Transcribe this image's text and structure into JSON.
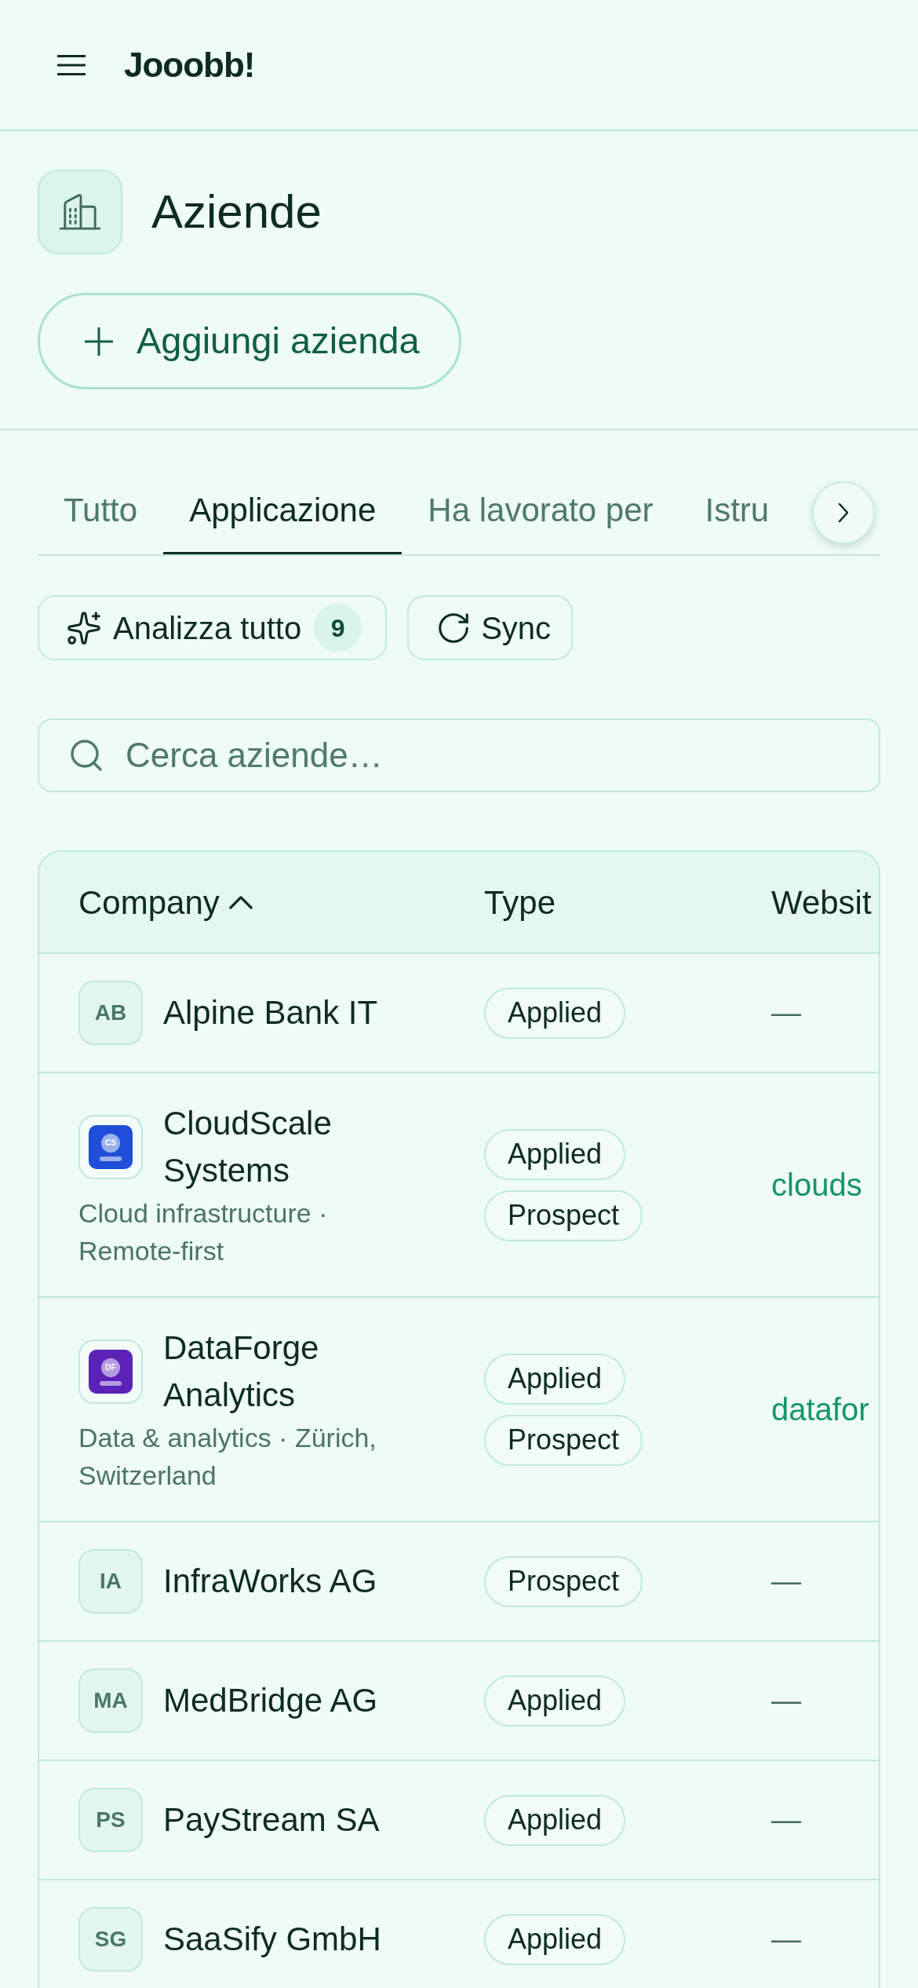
{
  "app_bar": {
    "title": "Jooobb!"
  },
  "page": {
    "title": "Aziende",
    "add_button": "Aggiungi azienda"
  },
  "tabs": [
    {
      "label": "Tutto",
      "selected": false
    },
    {
      "label": "Applicazione",
      "selected": true
    },
    {
      "label": "Ha lavorato per",
      "selected": false
    },
    {
      "label": "Istru",
      "selected": false
    }
  ],
  "actions": [
    {
      "kind": "analyze",
      "label": "Analizza tutto",
      "count": "9"
    },
    {
      "kind": "sync",
      "label": "Sync"
    }
  ],
  "search": {
    "placeholder": "Cerca aziende…"
  },
  "table": {
    "columns": [
      {
        "label": "Company",
        "sorted": true
      },
      {
        "label": "Type",
        "sorted": false
      },
      {
        "label": "Websit",
        "sorted": false
      }
    ],
    "rows": [
      {
        "avatar": {
          "kind": "initials",
          "text": "AB"
        },
        "name": "Alpine Bank IT",
        "types": [
          "Applied"
        ],
        "website": {
          "kind": "empty",
          "text": "—"
        }
      },
      {
        "avatar": {
          "kind": "logo",
          "text": "CS",
          "color": "#1f4fd8"
        },
        "name": "CloudScale Systems",
        "details": "Cloud infrastructure · Remote-first",
        "types": [
          "Applied",
          "Prospect"
        ],
        "website": {
          "kind": "link",
          "text": "clouds"
        }
      },
      {
        "avatar": {
          "kind": "logo",
          "text": "DF",
          "color": "#5b22b8"
        },
        "name": "DataForge Analytics",
        "details": "Data & analytics · Zürich, Switzerland",
        "types": [
          "Applied",
          "Prospect"
        ],
        "website": {
          "kind": "link",
          "text": "datafor"
        }
      },
      {
        "avatar": {
          "kind": "initials",
          "text": "IA"
        },
        "name": "InfraWorks AG",
        "types": [
          "Prospect"
        ],
        "website": {
          "kind": "empty",
          "text": "—"
        }
      },
      {
        "avatar": {
          "kind": "initials",
          "text": "MA"
        },
        "name": "MedBridge AG",
        "types": [
          "Applied"
        ],
        "website": {
          "kind": "empty",
          "text": "—"
        }
      },
      {
        "avatar": {
          "kind": "initials",
          "text": "PS"
        },
        "name": "PayStream SA",
        "types": [
          "Applied"
        ],
        "website": {
          "kind": "empty",
          "text": "—"
        }
      },
      {
        "avatar": {
          "kind": "initials",
          "text": "SG"
        },
        "name": "SaaSify GmbH",
        "types": [
          "Applied"
        ],
        "website": {
          "kind": "empty",
          "text": "—"
        }
      }
    ]
  }
}
